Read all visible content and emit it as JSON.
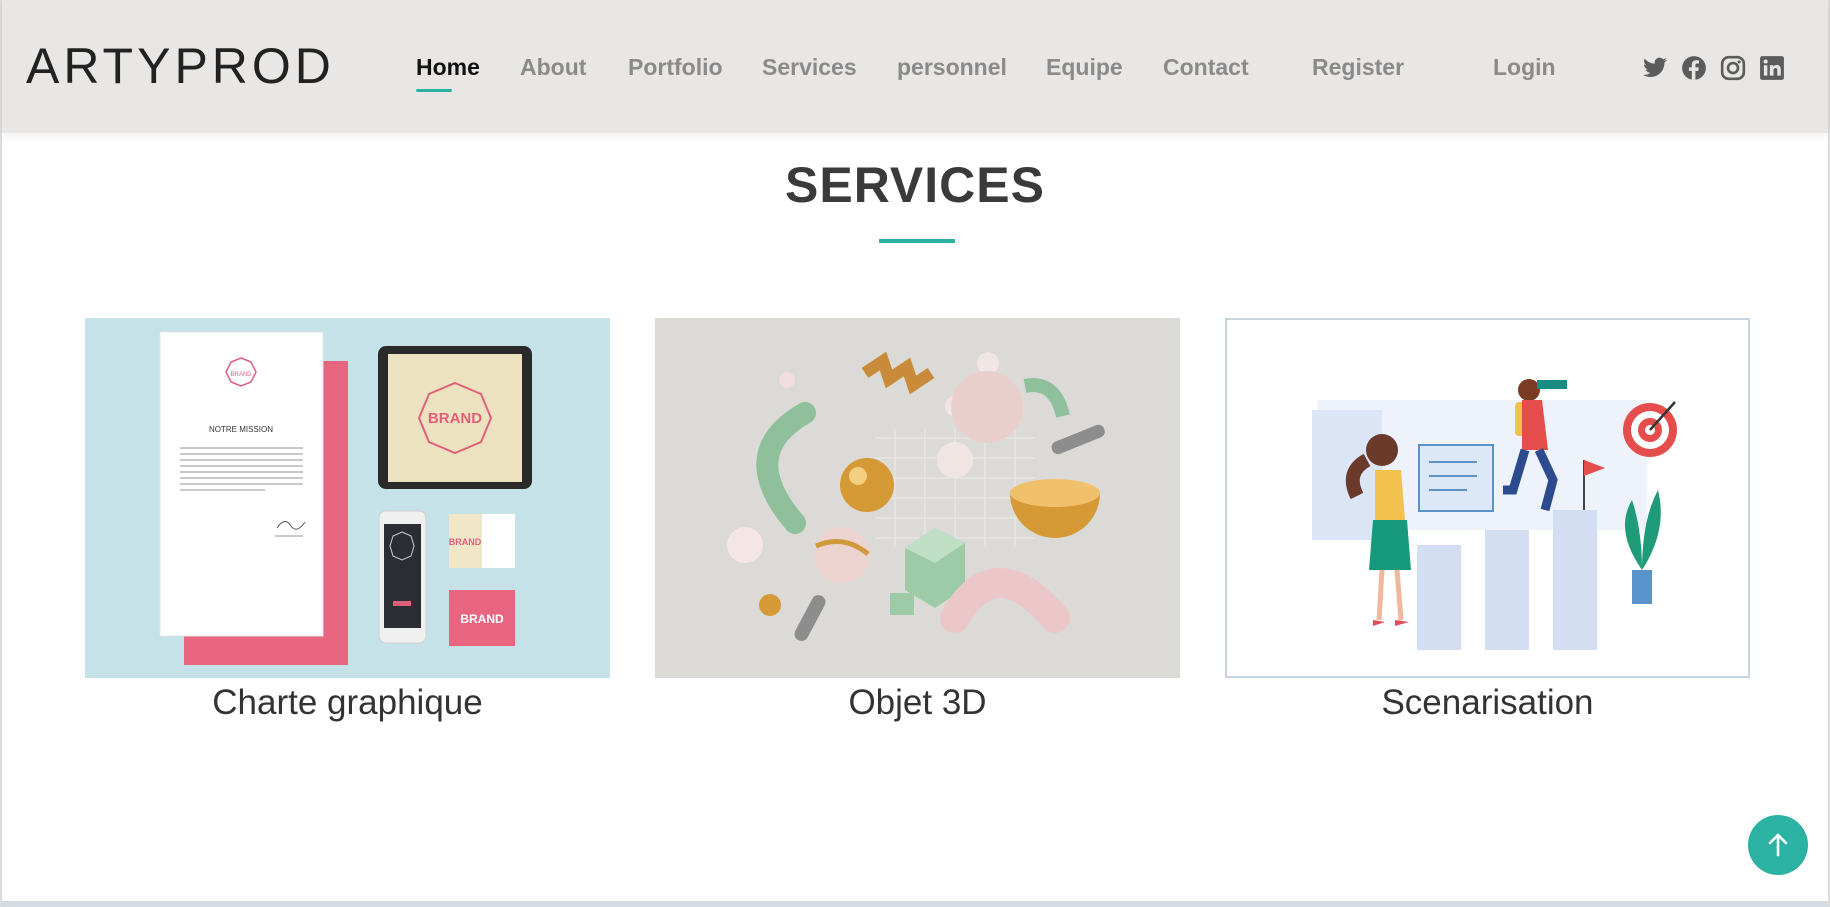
{
  "header": {
    "logo": "ARTYPROD",
    "nav": [
      {
        "label": "Home",
        "active": true
      },
      {
        "label": "About",
        "active": false
      },
      {
        "label": "Portfolio",
        "active": false
      },
      {
        "label": "Services",
        "active": false
      },
      {
        "label": "personnel",
        "active": false
      },
      {
        "label": "Equipe",
        "active": false
      },
      {
        "label": "Contact",
        "active": false
      },
      {
        "label": "Register",
        "active": false
      },
      {
        "label": "Login",
        "active": false
      }
    ],
    "social": [
      "twitter-icon",
      "facebook-icon",
      "instagram-icon",
      "linkedin-icon"
    ]
  },
  "services": {
    "title": "SERVICES",
    "cards": [
      {
        "label": "Charte graphique",
        "image": "brand-identity-mockup-image"
      },
      {
        "label": "Objet 3D",
        "image": "3d-objects-image"
      },
      {
        "label": "Scenarisation",
        "image": "planning-illustration-image"
      }
    ]
  },
  "mockup_text": {
    "mission": "NOTRE MISSION",
    "brand": "BRAND"
  },
  "colors": {
    "accent": "#2bb2a3",
    "header_bg": "#e8e7e5",
    "nav_inactive": "#8a8a8a",
    "nav_active": "#111111"
  },
  "back_to_top": "arrow-up-icon"
}
